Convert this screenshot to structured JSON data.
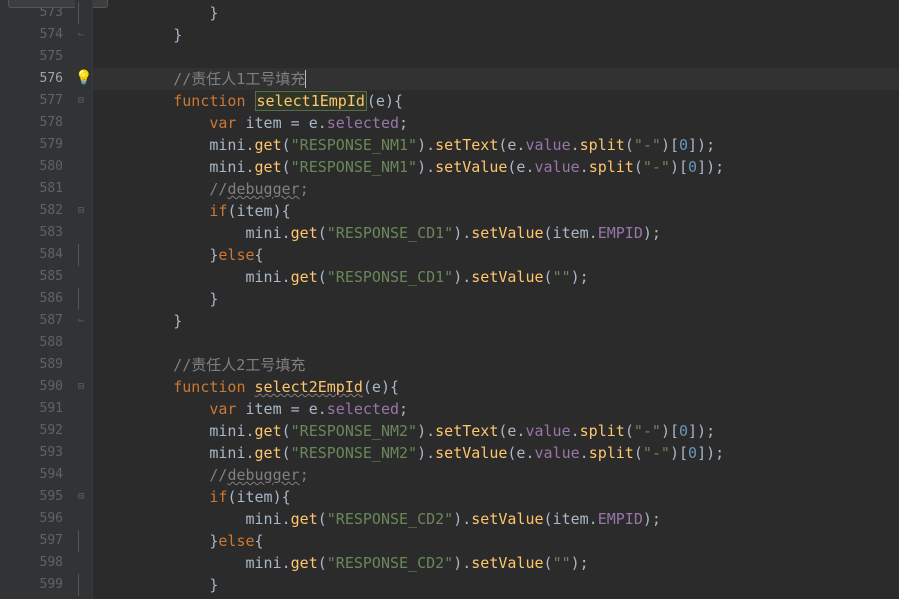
{
  "lines": [
    {
      "n": "573",
      "frag": [
        {
          "c": "ident",
          "t": "            }"
        }
      ]
    },
    {
      "n": "574",
      "frag": [
        {
          "c": "ident",
          "t": "        }"
        }
      ]
    },
    {
      "n": "575",
      "frag": []
    },
    {
      "n": "576",
      "current": true,
      "bulb": true,
      "frag": [
        {
          "c": "ident",
          "t": "        "
        },
        {
          "c": "com",
          "t": "//责任人1工号填充"
        },
        {
          "c": "cursor",
          "t": ""
        }
      ]
    },
    {
      "n": "577",
      "frag": [
        {
          "c": "ident",
          "t": "        "
        },
        {
          "c": "kw",
          "t": "function "
        },
        {
          "c": "fn-decl-boxed",
          "t": "select1EmpId"
        },
        {
          "c": "ident",
          "t": "(e){"
        }
      ]
    },
    {
      "n": "578",
      "frag": [
        {
          "c": "ident",
          "t": "            "
        },
        {
          "c": "kw",
          "t": "var "
        },
        {
          "c": "ident",
          "t": "item = e."
        },
        {
          "c": "prop",
          "t": "selected"
        },
        {
          "c": "ident",
          "t": ";"
        }
      ]
    },
    {
      "n": "579",
      "frag": [
        {
          "c": "ident",
          "t": "            mini."
        },
        {
          "c": "fn",
          "t": "get"
        },
        {
          "c": "ident",
          "t": "("
        },
        {
          "c": "str",
          "t": "\"RESPONSE_NM1\""
        },
        {
          "c": "ident",
          "t": ")."
        },
        {
          "c": "fn",
          "t": "setText"
        },
        {
          "c": "ident",
          "t": "(e."
        },
        {
          "c": "prop",
          "t": "value"
        },
        {
          "c": "ident",
          "t": "."
        },
        {
          "c": "fn",
          "t": "split"
        },
        {
          "c": "ident",
          "t": "("
        },
        {
          "c": "str",
          "t": "\"-\""
        },
        {
          "c": "ident",
          "t": ")["
        },
        {
          "c": "num",
          "t": "0"
        },
        {
          "c": "ident",
          "t": "]);"
        }
      ]
    },
    {
      "n": "580",
      "frag": [
        {
          "c": "ident",
          "t": "            mini."
        },
        {
          "c": "fn",
          "t": "get"
        },
        {
          "c": "ident",
          "t": "("
        },
        {
          "c": "str",
          "t": "\"RESPONSE_NM1\""
        },
        {
          "c": "ident",
          "t": ")."
        },
        {
          "c": "fn",
          "t": "setValue"
        },
        {
          "c": "ident",
          "t": "(e."
        },
        {
          "c": "prop",
          "t": "value"
        },
        {
          "c": "ident",
          "t": "."
        },
        {
          "c": "fn",
          "t": "split"
        },
        {
          "c": "ident",
          "t": "("
        },
        {
          "c": "str",
          "t": "\"-\""
        },
        {
          "c": "ident",
          "t": ")["
        },
        {
          "c": "num",
          "t": "0"
        },
        {
          "c": "ident",
          "t": "]);"
        }
      ]
    },
    {
      "n": "581",
      "frag": [
        {
          "c": "ident",
          "t": "            "
        },
        {
          "c": "com",
          "t": "//"
        },
        {
          "c": "com-wavy",
          "t": "debugger"
        },
        {
          "c": "com",
          "t": ";"
        }
      ]
    },
    {
      "n": "582",
      "frag": [
        {
          "c": "ident",
          "t": "            "
        },
        {
          "c": "kw",
          "t": "if"
        },
        {
          "c": "ident",
          "t": "(item){"
        }
      ]
    },
    {
      "n": "583",
      "frag": [
        {
          "c": "ident",
          "t": "                mini."
        },
        {
          "c": "fn",
          "t": "get"
        },
        {
          "c": "ident",
          "t": "("
        },
        {
          "c": "str",
          "t": "\"RESPONSE_CD1\""
        },
        {
          "c": "ident",
          "t": ")."
        },
        {
          "c": "fn",
          "t": "setValue"
        },
        {
          "c": "ident",
          "t": "(item."
        },
        {
          "c": "prop",
          "t": "EMPID"
        },
        {
          "c": "ident",
          "t": ");"
        }
      ]
    },
    {
      "n": "584",
      "frag": [
        {
          "c": "ident",
          "t": "            }"
        },
        {
          "c": "kw",
          "t": "else"
        },
        {
          "c": "ident",
          "t": "{"
        }
      ]
    },
    {
      "n": "585",
      "frag": [
        {
          "c": "ident",
          "t": "                mini."
        },
        {
          "c": "fn",
          "t": "get"
        },
        {
          "c": "ident",
          "t": "("
        },
        {
          "c": "str",
          "t": "\"RESPONSE_CD1\""
        },
        {
          "c": "ident",
          "t": ")."
        },
        {
          "c": "fn",
          "t": "setValue"
        },
        {
          "c": "ident",
          "t": "("
        },
        {
          "c": "str",
          "t": "\"\""
        },
        {
          "c": "ident",
          "t": ");"
        }
      ]
    },
    {
      "n": "586",
      "frag": [
        {
          "c": "ident",
          "t": "            }"
        }
      ]
    },
    {
      "n": "587",
      "frag": [
        {
          "c": "ident",
          "t": "        }"
        }
      ]
    },
    {
      "n": "588",
      "frag": []
    },
    {
      "n": "589",
      "frag": [
        {
          "c": "ident",
          "t": "        "
        },
        {
          "c": "com",
          "t": "//责任人2工号填充"
        }
      ]
    },
    {
      "n": "590",
      "frag": [
        {
          "c": "ident",
          "t": "        "
        },
        {
          "c": "kw",
          "t": "function "
        },
        {
          "c": "fn-decl-wavy",
          "t": "select2EmpId"
        },
        {
          "c": "ident",
          "t": "(e){"
        }
      ]
    },
    {
      "n": "591",
      "frag": [
        {
          "c": "ident",
          "t": "            "
        },
        {
          "c": "kw",
          "t": "var "
        },
        {
          "c": "ident",
          "t": "item = e."
        },
        {
          "c": "prop",
          "t": "selected"
        },
        {
          "c": "ident",
          "t": ";"
        }
      ]
    },
    {
      "n": "592",
      "frag": [
        {
          "c": "ident",
          "t": "            mini."
        },
        {
          "c": "fn",
          "t": "get"
        },
        {
          "c": "ident",
          "t": "("
        },
        {
          "c": "str",
          "t": "\"RESPONSE_NM2\""
        },
        {
          "c": "ident",
          "t": ")."
        },
        {
          "c": "fn",
          "t": "setText"
        },
        {
          "c": "ident",
          "t": "(e."
        },
        {
          "c": "prop",
          "t": "value"
        },
        {
          "c": "ident",
          "t": "."
        },
        {
          "c": "fn",
          "t": "split"
        },
        {
          "c": "ident",
          "t": "("
        },
        {
          "c": "str",
          "t": "\"-\""
        },
        {
          "c": "ident",
          "t": ")["
        },
        {
          "c": "num",
          "t": "0"
        },
        {
          "c": "ident",
          "t": "]);"
        }
      ]
    },
    {
      "n": "593",
      "frag": [
        {
          "c": "ident",
          "t": "            mini."
        },
        {
          "c": "fn",
          "t": "get"
        },
        {
          "c": "ident",
          "t": "("
        },
        {
          "c": "str",
          "t": "\"RESPONSE_NM2\""
        },
        {
          "c": "ident",
          "t": ")."
        },
        {
          "c": "fn",
          "t": "setValue"
        },
        {
          "c": "ident",
          "t": "(e."
        },
        {
          "c": "prop",
          "t": "value"
        },
        {
          "c": "ident",
          "t": "."
        },
        {
          "c": "fn",
          "t": "split"
        },
        {
          "c": "ident",
          "t": "("
        },
        {
          "c": "str",
          "t": "\"-\""
        },
        {
          "c": "ident",
          "t": ")["
        },
        {
          "c": "num",
          "t": "0"
        },
        {
          "c": "ident",
          "t": "]);"
        }
      ]
    },
    {
      "n": "594",
      "frag": [
        {
          "c": "ident",
          "t": "            "
        },
        {
          "c": "com",
          "t": "//"
        },
        {
          "c": "com-wavy",
          "t": "debugger"
        },
        {
          "c": "com",
          "t": ";"
        }
      ]
    },
    {
      "n": "595",
      "frag": [
        {
          "c": "ident",
          "t": "            "
        },
        {
          "c": "kw",
          "t": "if"
        },
        {
          "c": "ident",
          "t": "(item){"
        }
      ]
    },
    {
      "n": "596",
      "frag": [
        {
          "c": "ident",
          "t": "                mini."
        },
        {
          "c": "fn",
          "t": "get"
        },
        {
          "c": "ident",
          "t": "("
        },
        {
          "c": "str",
          "t": "\"RESPONSE_CD2\""
        },
        {
          "c": "ident",
          "t": ")."
        },
        {
          "c": "fn",
          "t": "setValue"
        },
        {
          "c": "ident",
          "t": "(item."
        },
        {
          "c": "prop",
          "t": "EMPID"
        },
        {
          "c": "ident",
          "t": ");"
        }
      ]
    },
    {
      "n": "597",
      "frag": [
        {
          "c": "ident",
          "t": "            }"
        },
        {
          "c": "kw",
          "t": "else"
        },
        {
          "c": "ident",
          "t": "{"
        }
      ]
    },
    {
      "n": "598",
      "frag": [
        {
          "c": "ident",
          "t": "                mini."
        },
        {
          "c": "fn",
          "t": "get"
        },
        {
          "c": "ident",
          "t": "("
        },
        {
          "c": "str",
          "t": "\"RESPONSE_CD2\""
        },
        {
          "c": "ident",
          "t": ")."
        },
        {
          "c": "fn",
          "t": "setValue"
        },
        {
          "c": "ident",
          "t": "("
        },
        {
          "c": "str",
          "t": "\"\""
        },
        {
          "c": "ident",
          "t": ");"
        }
      ]
    },
    {
      "n": "599",
      "frag": [
        {
          "c": "ident",
          "t": "            }"
        }
      ]
    }
  ],
  "fold_markers": {
    "573": "bar",
    "574": "close",
    "577": "open",
    "582": "open",
    "584": "mid",
    "586": "bar",
    "587": "close",
    "590": "open",
    "595": "open",
    "597": "mid",
    "599": "bar"
  }
}
